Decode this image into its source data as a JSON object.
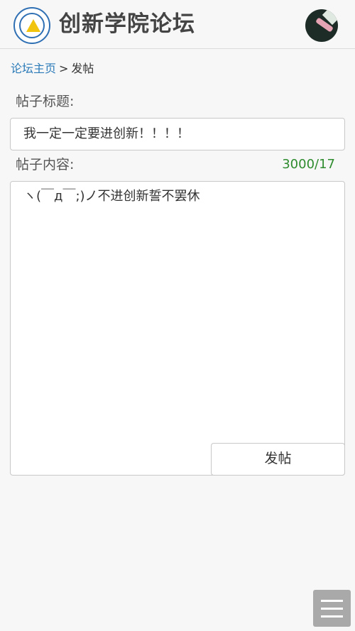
{
  "header": {
    "site_title": "创新学院论坛",
    "logo_icon": "school-emblem-icon",
    "avatar_icon": "user-avatar-icon"
  },
  "breadcrumb": {
    "home_link": "论坛主页",
    "separator": ">",
    "current": "发帖"
  },
  "form": {
    "title_label": "帖子标题:",
    "title_value": "我一定一定要进创新！！！！",
    "content_label": "帖子内容:",
    "char_counter": "3000/17",
    "content_value": "ヽ(￣д￣;)ノ不进创新誓不罢休",
    "submit_label": "发帖"
  },
  "floating_menu": {
    "icon": "hamburger-menu-icon"
  },
  "colors": {
    "link": "#2a7ab8",
    "counter": "#2e8b2e",
    "background": "#f7f7f7",
    "menu_button": "#a9a9a9"
  }
}
